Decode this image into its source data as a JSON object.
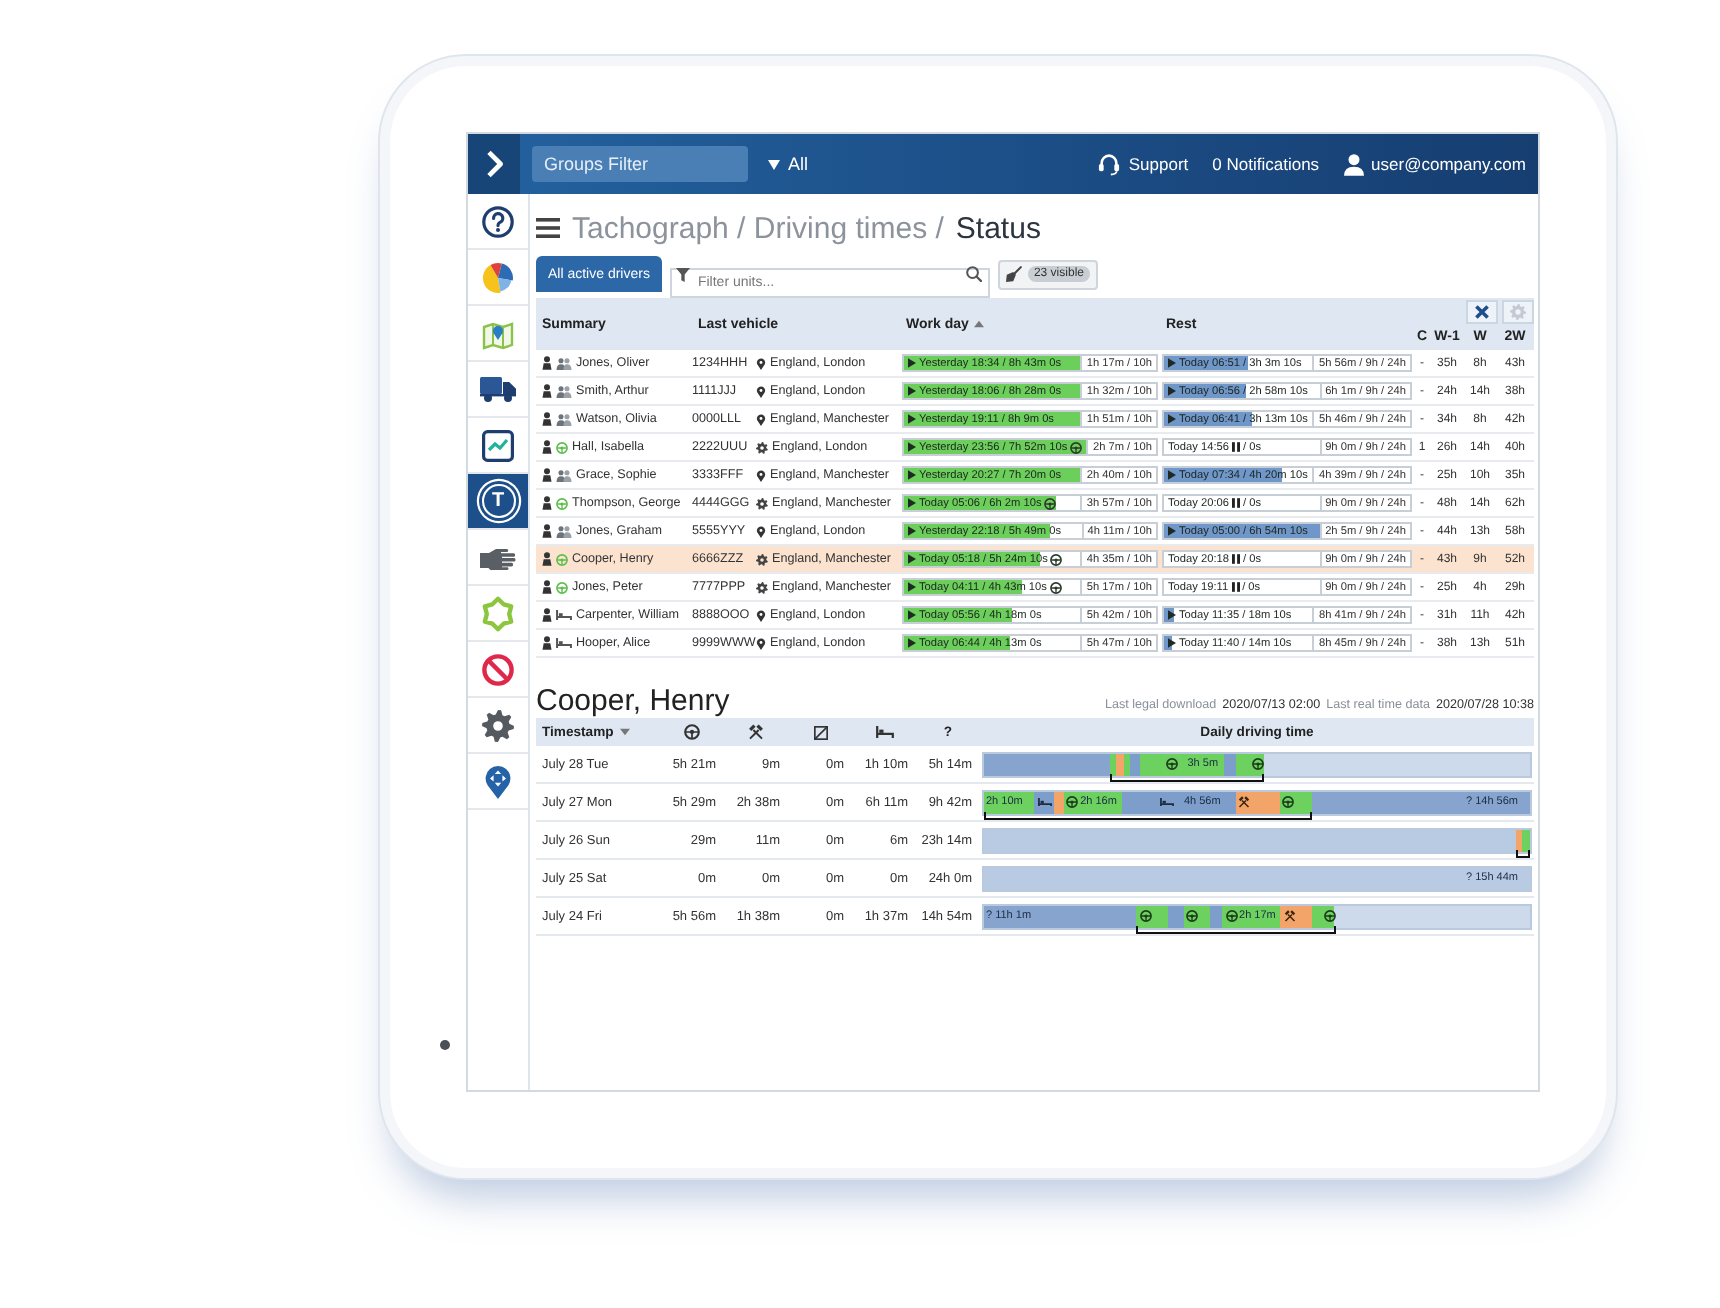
{
  "header": {
    "groups_filter": {
      "placeholder": "Groups Filter"
    },
    "group_select": {
      "value": "All"
    },
    "links": [
      {
        "kind": "support",
        "label": "Support"
      },
      {
        "kind": "notifications",
        "label": "0 Notifications"
      },
      {
        "kind": "user",
        "label": "user@company.com"
      }
    ]
  },
  "sidebar": {
    "items": [
      {
        "kind": "help",
        "selected": false
      },
      {
        "kind": "pie",
        "selected": false
      },
      {
        "kind": "map",
        "selected": false
      },
      {
        "kind": "truck",
        "selected": false
      },
      {
        "kind": "chart",
        "selected": false
      },
      {
        "kind": "tachograph",
        "label": "T",
        "selected": true
      },
      {
        "kind": "hand",
        "selected": false
      },
      {
        "kind": "star",
        "selected": false
      },
      {
        "kind": "prohibited",
        "selected": false
      },
      {
        "kind": "settings",
        "selected": false
      },
      {
        "kind": "location",
        "selected": false
      }
    ]
  },
  "breadcrumb": {
    "trail": "Tachograph / Driving times /",
    "current": "Status"
  },
  "toolbar": {
    "scope_button": "All active drivers",
    "filter": {
      "placeholder": "Filter units..."
    },
    "visible_count": "23 visible"
  },
  "drivers": {
    "columns": [
      {
        "label": "Summary"
      },
      {
        "label": "Last vehicle"
      },
      {
        "label": "Work day",
        "sort": {
          "kind": "asc"
        }
      },
      {
        "label": "Rest"
      }
    ],
    "counter_columns": [
      "C",
      "W-1",
      "W",
      "2W"
    ],
    "rows": [
      {
        "name": "Jones, Oliver",
        "status": {
          "kind": "crew"
        },
        "vehicle": "1234HHH",
        "place": {
          "kind": "pin",
          "name": "England, London"
        },
        "work_day": {
          "kind": "running",
          "label": "Yesterday 18:34 / 8h 43m 0s",
          "driving": false,
          "reading": "1h 17m / 10h",
          "level": 0.87
        },
        "rest": {
          "kind": "running",
          "label": "Today 06:51 / 3h 3m 10s",
          "reading": "5h 56m / 9h / 24h",
          "level": 0.34
        },
        "counters": [
          "-",
          "35h",
          "8h",
          "43h"
        ],
        "selected": false
      },
      {
        "name": "Smith, Arthur",
        "status": {
          "kind": "crew"
        },
        "vehicle": "1111JJJ",
        "place": {
          "kind": "pin",
          "name": "England, London"
        },
        "work_day": {
          "kind": "running",
          "label": "Yesterday 18:06 / 8h 28m 0s",
          "driving": false,
          "reading": "1h 32m / 10h",
          "level": 0.85
        },
        "rest": {
          "kind": "running",
          "label": "Today 06:56 / 2h 58m 10s",
          "reading": "6h 1m / 9h / 24h",
          "level": 0.33
        },
        "counters": [
          "-",
          "24h",
          "14h",
          "38h"
        ],
        "selected": false
      },
      {
        "name": "Watson, Olivia",
        "status": {
          "kind": "crew"
        },
        "vehicle": "0000LLL",
        "place": {
          "kind": "pin",
          "name": "England, Manchester"
        },
        "work_day": {
          "kind": "running",
          "label": "Yesterday 19:11 / 8h 9m 0s",
          "driving": false,
          "reading": "1h 51m / 10h",
          "level": 0.82
        },
        "rest": {
          "kind": "running",
          "label": "Today 06:41 / 3h 13m 10s",
          "reading": "5h 46m / 9h / 24h",
          "level": 0.36
        },
        "counters": [
          "-",
          "34h",
          "8h",
          "42h"
        ],
        "selected": false
      },
      {
        "name": "Hall, Isabella",
        "status": {
          "kind": "wheel"
        },
        "vehicle": "2222UUU",
        "place": {
          "kind": "gear",
          "name": "England, London"
        },
        "work_day": {
          "kind": "running",
          "label": "Yesterday 23:56 / 7h 52m 10s",
          "driving": true,
          "reading": "2h 7m / 10h",
          "level": 0.79
        },
        "rest": {
          "kind": "paused",
          "label": "Today 14:56",
          "after": "/ 0s",
          "reading": "9h 0m / 9h / 24h"
        },
        "counters": [
          "1",
          "26h",
          "14h",
          "40h"
        ],
        "selected": false
      },
      {
        "name": "Grace, Sophie",
        "status": {
          "kind": "crew"
        },
        "vehicle": "3333FFF",
        "place": {
          "kind": "pin",
          "name": "England, Manchester"
        },
        "work_day": {
          "kind": "running",
          "label": "Yesterday 20:27 / 7h 20m 0s",
          "driving": false,
          "reading": "2h 40m / 10h",
          "level": 0.73
        },
        "rest": {
          "kind": "running",
          "label": "Today 07:34 / 4h 20m 10s",
          "reading": "4h 39m / 9h / 24h",
          "level": 0.48
        },
        "counters": [
          "-",
          "25h",
          "10h",
          "35h"
        ],
        "selected": false
      },
      {
        "name": "Thompson, George",
        "status": {
          "kind": "wheel"
        },
        "vehicle": "4444GGG",
        "place": {
          "kind": "gear",
          "name": "England, Manchester"
        },
        "work_day": {
          "kind": "running",
          "label": "Today 05:06 / 6h 2m 10s",
          "driving": true,
          "reading": "3h 57m / 10h",
          "level": 0.6
        },
        "rest": {
          "kind": "paused",
          "label": "Today 20:06",
          "after": "/ 0s",
          "reading": "9h 0m / 9h / 24h"
        },
        "counters": [
          "-",
          "48h",
          "14h",
          "62h"
        ],
        "selected": false
      },
      {
        "name": "Jones, Graham",
        "status": {
          "kind": "crew"
        },
        "vehicle": "5555YYY",
        "place": {
          "kind": "pin",
          "name": "England, London"
        },
        "work_day": {
          "kind": "running",
          "label": "Yesterday 22:18 / 5h 49m 0s",
          "driving": false,
          "reading": "4h 11m / 10h",
          "level": 0.58
        },
        "rest": {
          "kind": "running",
          "label": "Today 05:00 / 6h 54m 10s",
          "reading": "2h 5m / 9h / 24h",
          "level": 0.77
        },
        "counters": [
          "-",
          "44h",
          "13h",
          "58h"
        ],
        "selected": false
      },
      {
        "name": "Cooper, Henry",
        "status": {
          "kind": "wheel"
        },
        "vehicle": "6666ZZZ",
        "place": {
          "kind": "gear",
          "name": "England, Manchester"
        },
        "work_day": {
          "kind": "running",
          "label": "Today 05:18 / 5h 24m 10s",
          "driving": true,
          "reading": "4h 35m / 10h",
          "level": 0.54
        },
        "rest": {
          "kind": "paused",
          "label": "Today 20:18",
          "after": "/ 0s",
          "reading": "9h 0m / 9h / 24h"
        },
        "counters": [
          "-",
          "43h",
          "9h",
          "52h"
        ],
        "selected": true
      },
      {
        "name": "Jones, Peter",
        "status": {
          "kind": "wheel"
        },
        "vehicle": "7777PPP",
        "place": {
          "kind": "gear",
          "name": "England, Manchester"
        },
        "work_day": {
          "kind": "running",
          "label": "Today 04:11 / 4h 43m 10s",
          "driving": true,
          "reading": "5h 17m / 10h",
          "level": 0.47
        },
        "rest": {
          "kind": "paused",
          "label": "Today 19:11",
          "after": "/ 0s",
          "reading": "9h 0m / 9h / 24h"
        },
        "counters": [
          "-",
          "25h",
          "4h",
          "29h"
        ],
        "selected": false
      },
      {
        "name": "Carpenter, William",
        "status": {
          "kind": "rest"
        },
        "vehicle": "8888OOO",
        "place": {
          "kind": "pin",
          "name": "England, London"
        },
        "work_day": {
          "kind": "running",
          "label": "Today 05:56 / 4h 18m 0s",
          "driving": false,
          "reading": "5h 42m / 10h",
          "level": 0.43
        },
        "rest": {
          "kind": "running",
          "label": "Today 11:35 / 18m 10s",
          "reading": "8h 41m / 9h / 24h",
          "level": 0.04
        },
        "counters": [
          "-",
          "31h",
          "11h",
          "42h"
        ],
        "selected": false
      },
      {
        "name": "Hooper, Alice",
        "status": {
          "kind": "rest"
        },
        "vehicle": "9999WWW",
        "place": {
          "kind": "pin",
          "name": "England, London"
        },
        "work_day": {
          "kind": "running",
          "label": "Today 06:44 / 4h 13m 0s",
          "driving": false,
          "reading": "5h 47m / 10h",
          "level": 0.42
        },
        "rest": {
          "kind": "running",
          "label": "Today 11:40 / 14m 10s",
          "reading": "8h 45m / 9h / 24h",
          "level": 0.03
        },
        "counters": [
          "-",
          "38h",
          "13h",
          "51h"
        ],
        "selected": false
      }
    ]
  },
  "details": {
    "title": "Cooper, Henry",
    "meta": [
      {
        "label": "Last legal download",
        "value": "2020/07/13 02:00"
      },
      {
        "label": "Last real time data",
        "value": "2020/07/28 10:38"
      }
    ],
    "columns": [
      {
        "kind": "text",
        "label": "Timestamp",
        "sort": {
          "kind": "desc"
        }
      },
      {
        "kind": "driving"
      },
      {
        "kind": "work"
      },
      {
        "kind": "available"
      },
      {
        "kind": "rest"
      },
      {
        "kind": "text",
        "label": "?"
      },
      {
        "kind": "text",
        "label": "Daily driving time"
      }
    ],
    "rows": [
      {
        "date": "July 28 Tue",
        "values": [
          "5h 21m",
          "9m",
          "0m",
          "1h 10m",
          "5h 14m"
        ],
        "timeline": [
          {
            "kind": "unknown",
            "icon": false
          },
          {
            "kind": "driving",
            "icon": false
          },
          {
            "kind": "work",
            "icon": false
          },
          {
            "kind": "driving",
            "icon": false
          },
          {
            "kind": "rest",
            "icon": false
          },
          {
            "kind": "driving",
            "icon": true,
            "label": "3h 5m"
          },
          {
            "kind": "rest",
            "icon": false
          },
          {
            "kind": "driving",
            "icon": true
          }
        ]
      },
      {
        "date": "July 27 Mon",
        "values": [
          "5h 29m",
          "2h 38m",
          "0m",
          "6h 11m",
          "9h 42m"
        ],
        "timeline": [
          {
            "kind": "driving",
            "icon": false,
            "label": "2h 10m"
          },
          {
            "kind": "rest",
            "icon": true
          },
          {
            "kind": "work",
            "icon": false
          },
          {
            "kind": "driving",
            "icon": true,
            "label": "2h 16m"
          },
          {
            "kind": "rest",
            "icon": true,
            "label": "4h 56m"
          },
          {
            "kind": "work",
            "icon": true
          },
          {
            "kind": "driving",
            "icon": true
          },
          {
            "kind": "unknown",
            "icon": false,
            "label": "? 14h 56m"
          }
        ]
      },
      {
        "date": "July 26 Sun",
        "values": [
          "29m",
          "11m",
          "0m",
          "6m",
          "23h 14m"
        ],
        "timeline": [
          {
            "kind": "nodata",
            "icon": false
          },
          {
            "kind": "work",
            "icon": false
          },
          {
            "kind": "driving",
            "icon": false
          }
        ]
      },
      {
        "date": "July 25 Sat",
        "values": [
          "0m",
          "0m",
          "0m",
          "0m",
          "24h 0m"
        ],
        "timeline": [
          {
            "kind": "nodata",
            "icon": false,
            "label": "? 15h 44m"
          }
        ]
      },
      {
        "date": "July 24 Fri",
        "values": [
          "5h 56m",
          "1h 38m",
          "0m",
          "1h 37m",
          "14h 54m"
        ],
        "timeline": [
          {
            "kind": "unknown",
            "icon": false,
            "label": "? 11h 1m"
          },
          {
            "kind": "driving",
            "icon": true
          },
          {
            "kind": "rest",
            "icon": false
          },
          {
            "kind": "driving",
            "icon": true
          },
          {
            "kind": "rest",
            "icon": false
          },
          {
            "kind": "driving",
            "icon": true,
            "label": "2h 17m"
          },
          {
            "kind": "work",
            "icon": true
          },
          {
            "kind": "driving",
            "icon": true
          }
        ]
      }
    ]
  }
}
